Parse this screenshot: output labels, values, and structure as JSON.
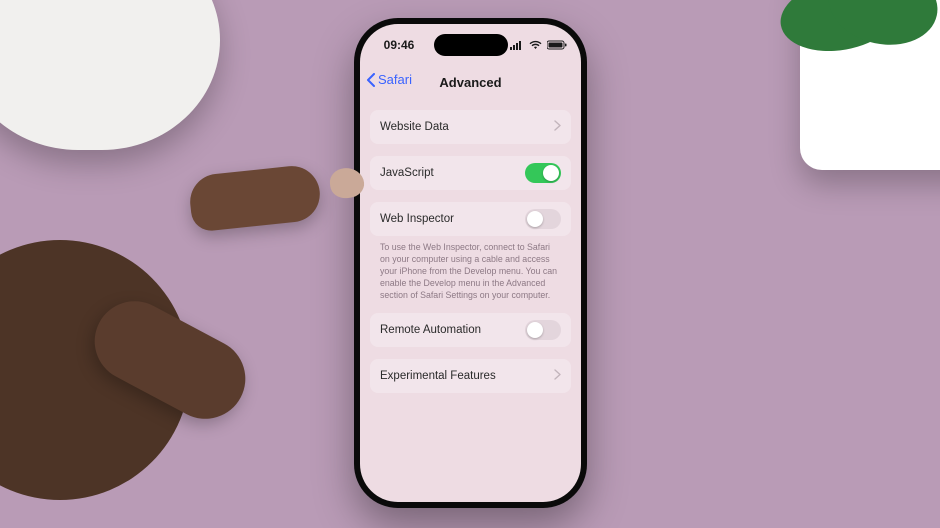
{
  "status": {
    "time": "09:46"
  },
  "nav": {
    "back": "Safari",
    "title": "Advanced"
  },
  "rows": {
    "website_data": "Website Data",
    "javascript": "JavaScript",
    "web_inspector": "Web Inspector",
    "web_inspector_footer": "To use the Web Inspector, connect to Safari on your computer using a cable and access your iPhone from the Develop menu. You can enable the Develop menu in the Advanced section of Safari Settings on your computer.",
    "remote_automation": "Remote Automation",
    "experimental_features": "Experimental Features"
  },
  "toggles": {
    "javascript": true,
    "web_inspector": false,
    "remote_automation": false
  },
  "colors": {
    "accent_toggle_on": "#34c759",
    "link": "#3a63ff"
  }
}
